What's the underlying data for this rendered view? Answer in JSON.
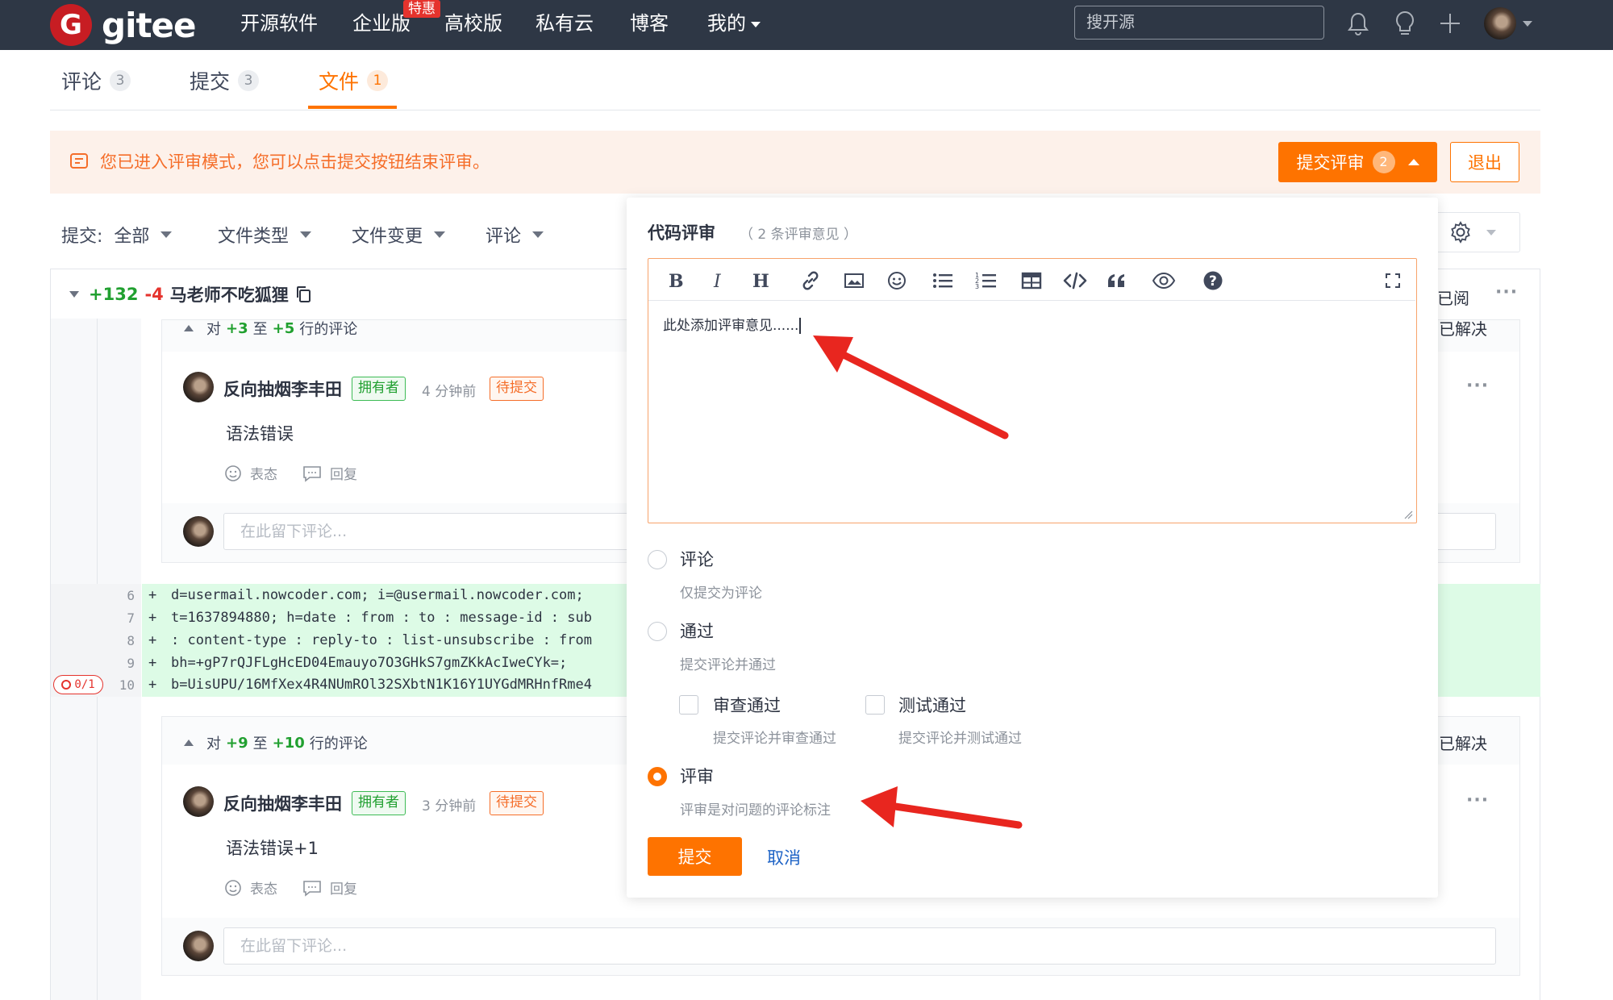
{
  "topnav": {
    "logo_letter": "G",
    "logo_text": "gitee",
    "items": [
      "开源软件",
      "企业版",
      "高校版",
      "私有云",
      "博客",
      "我的"
    ],
    "enterprise_badge": "特惠",
    "search_placeholder": "搜开源",
    "icons": [
      "bell-icon",
      "lightbulb-icon",
      "plus-icon",
      "avatar",
      "chevron-down-icon"
    ]
  },
  "tabs": [
    {
      "label": "评论",
      "count": "3"
    },
    {
      "label": "提交",
      "count": "3"
    },
    {
      "label": "文件",
      "count": "1",
      "active": true
    }
  ],
  "banner": {
    "text": "您已进入评审模式，您可以点击提交按钮结束评审。",
    "submit_label": "提交评审",
    "submit_count": "2",
    "exit_label": "退出"
  },
  "filters": {
    "commit_label": "提交:",
    "commit_value": "全部",
    "file_type": "文件类型",
    "file_change": "文件变更",
    "comment": "评论"
  },
  "file": {
    "additions": "+132",
    "deletions": "-4",
    "name": "马老师不吃狐狸",
    "viewed_label": "已阅"
  },
  "threads": [
    {
      "range_prefix": "对",
      "range_from": "+3",
      "range_mid": "至",
      "range_to": "+5",
      "range_suffix": "行的评论",
      "resolved_label": "已解决",
      "author": "反向抽烟李丰田",
      "owner_tag": "拥有者",
      "time": "4 分钟前",
      "status_tag": "待提交",
      "text": "语法错误",
      "react_label": "表态",
      "reply_label": "回复",
      "reply_placeholder": "在此留下评论..."
    },
    {
      "range_prefix": "对",
      "range_from": "+9",
      "range_mid": "至",
      "range_to": "+10",
      "range_suffix": "行的评论",
      "resolved_label": "已解决",
      "author": "反向抽烟李丰田",
      "owner_tag": "拥有者",
      "time": "3 分钟前",
      "status_tag": "待提交",
      "text": "语法错误+1",
      "react_label": "表态",
      "reply_label": "回复",
      "reply_placeholder": "在此留下评论..."
    }
  ],
  "code": {
    "lines": [
      {
        "no": "6",
        "text": "d=usermail.nowcoder.com; i=@usermail.nowcoder.com;"
      },
      {
        "no": "7",
        "text": "t=1637894880; h=date : from : to : message-id : sub"
      },
      {
        "no": "8",
        "text": ": content-type : reply-to : list-unsubscribe : from"
      },
      {
        "no": "9",
        "text": "bh=+gP7rQJFLgHcED04Emauyo7O3GHkS7gmZKkAcIweCYk=;"
      },
      {
        "no": "10",
        "text": "b=UisUPU/16MfXex4R4NUmROl32SXbtN1K16Y1UYGdMRHnfRme4"
      }
    ],
    "issue_badge": "0/1"
  },
  "popup": {
    "title": "代码评审",
    "subtitle": "（ 2 条评审意见 ）",
    "editor_text": "此处添加评审意见......",
    "toolbar": [
      "bold-icon",
      "italic-icon",
      "heading-icon",
      "link-icon",
      "image-icon",
      "emoji-icon",
      "bullet-list-icon",
      "ordered-list-icon",
      "table-icon",
      "code-icon",
      "quote-icon",
      "preview-icon",
      "help-icon",
      "fullscreen-icon"
    ],
    "options": [
      {
        "label": "评论",
        "desc": "仅提交为评论",
        "checked": false
      },
      {
        "label": "通过",
        "desc": "提交评论并通过",
        "checked": false
      },
      {
        "label": "评审",
        "desc": "评审是对问题的评论标注",
        "checked": true
      }
    ],
    "sub_options": [
      {
        "label": "审查通过",
        "desc": "提交评论并审查通过"
      },
      {
        "label": "测试通过",
        "desc": "提交评论并测试通过"
      }
    ],
    "submit_label": "提交",
    "cancel_label": "取消"
  },
  "colors": {
    "accent": "#fe7300",
    "nav_bg": "#2e3745",
    "added_line_bg": "#ddfbe6",
    "arrow": "#e8261f"
  }
}
